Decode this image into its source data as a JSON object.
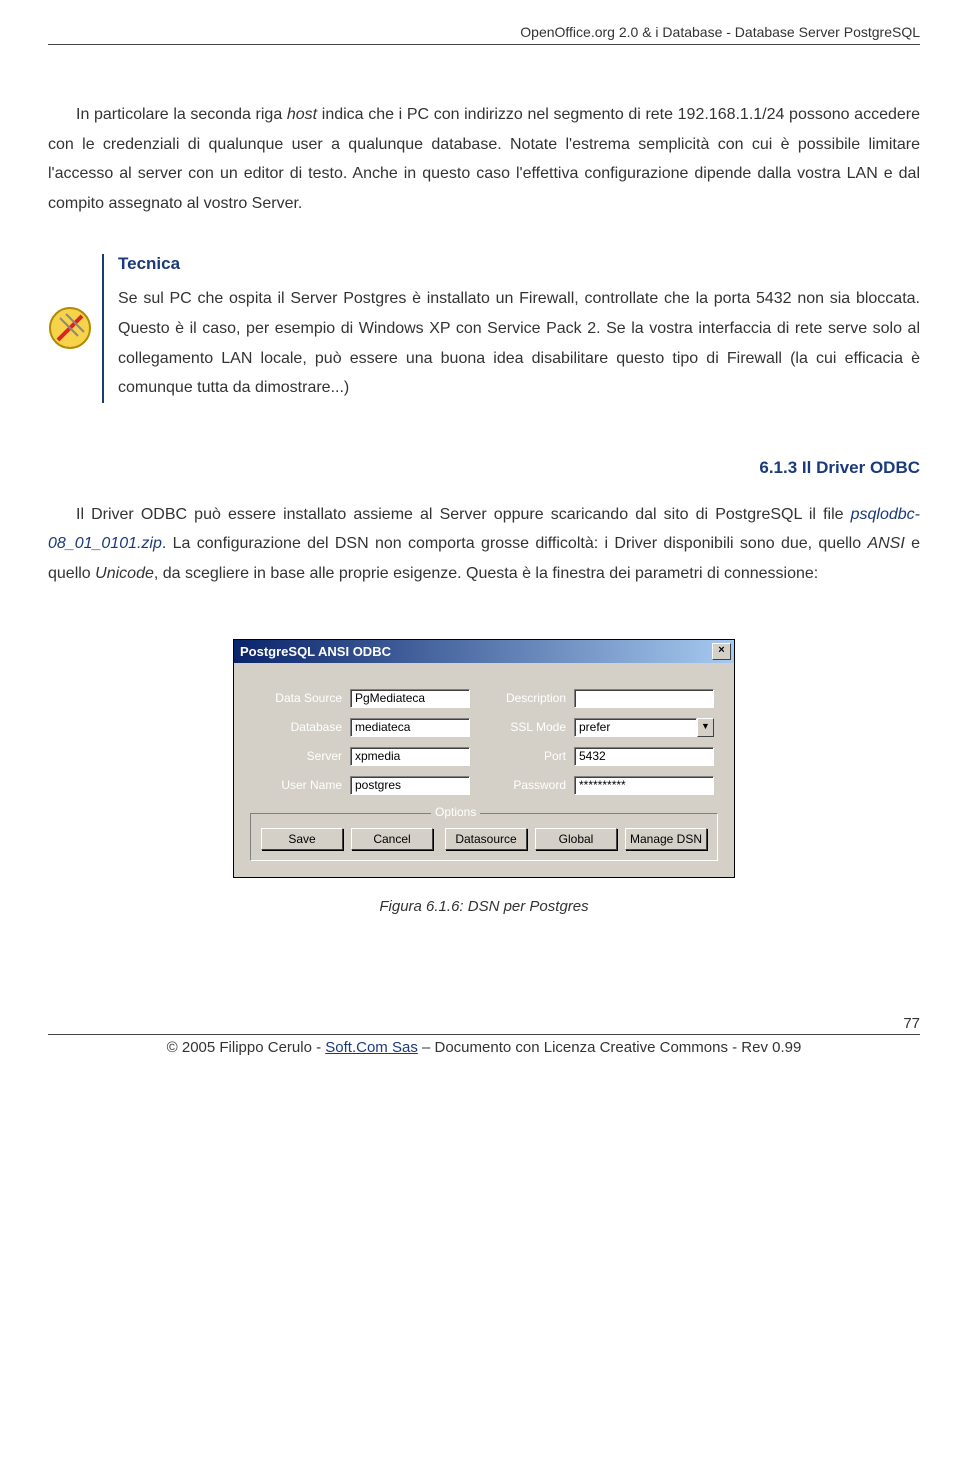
{
  "document_header": "OpenOffice.org 2.0 & i Database -  Database Server PostgreSQL",
  "para1": {
    "pre": "In particolare la seconda riga ",
    "host": "host",
    "post": " indica che i PC con indirizzo nel segmento di rete 192.168.1.1/24 possono accedere con le credenziali di qualunque user a qualunque database. Notate l'estrema semplicità con cui è possibile limitare l'accesso al server con un editor di testo. Anche in questo caso l'effettiva configurazione dipende dalla vostra LAN e dal compito assegnato al vostro Server."
  },
  "tecnica": {
    "title": "Tecnica",
    "text": "Se sul PC che ospita il Server Postgres è installato un Firewall, controllate che la porta 5432 non sia bloccata. Questo è il caso, per esempio di Windows XP con Service Pack 2. Se la vostra interfaccia di rete serve solo al collegamento LAN locale, può essere una buona idea disabilitare questo tipo di Firewall (la cui efficacia è comunque tutta da dimostrare...)"
  },
  "section_heading": "6.1.3 Il Driver ODBC",
  "para2": {
    "pre": "Il Driver ODBC può essere installato assieme al Server oppure scaricando dal sito di PostgreSQL il file ",
    "file": "psqlodbc-08_01_0101.zip",
    "mid": ". La configurazione del DSN non comporta grosse difficoltà: i Driver disponibili sono due, quello ",
    "ansi": "ANSI",
    "mid2": " e quello ",
    "unicode": "Unicode",
    "post": ", da scegliere in base alle proprie esigenze. Questa è la finestra dei parametri di connessione:"
  },
  "dialog": {
    "title": "PostgreSQL ANSI ODBC",
    "close": "×",
    "labels": {
      "data_source": "Data Source",
      "database": "Database",
      "server": "Server",
      "user_name": "User Name",
      "description": "Description",
      "ssl_mode": "SSL Mode",
      "port": "Port",
      "password": "Password"
    },
    "values": {
      "data_source": "PgMediateca",
      "database": "mediateca",
      "server": "xpmedia",
      "user_name": "postgres",
      "description": "",
      "ssl_mode": "prefer",
      "port": "5432",
      "password": "**********"
    },
    "options_legend": "Options",
    "buttons": {
      "save": "Save",
      "cancel": "Cancel",
      "datasource": "Datasource",
      "global": "Global",
      "manage_dsn": "Manage DSN"
    }
  },
  "figure_caption": "Figura 6.1.6: DSN per Postgres",
  "page_number": "77",
  "footer": {
    "pre": "© 2005 Filippo Cerulo - ",
    "link": "Soft.Com Sas",
    "post": " – Documento con Licenza Creative Commons - Rev 0.99"
  }
}
